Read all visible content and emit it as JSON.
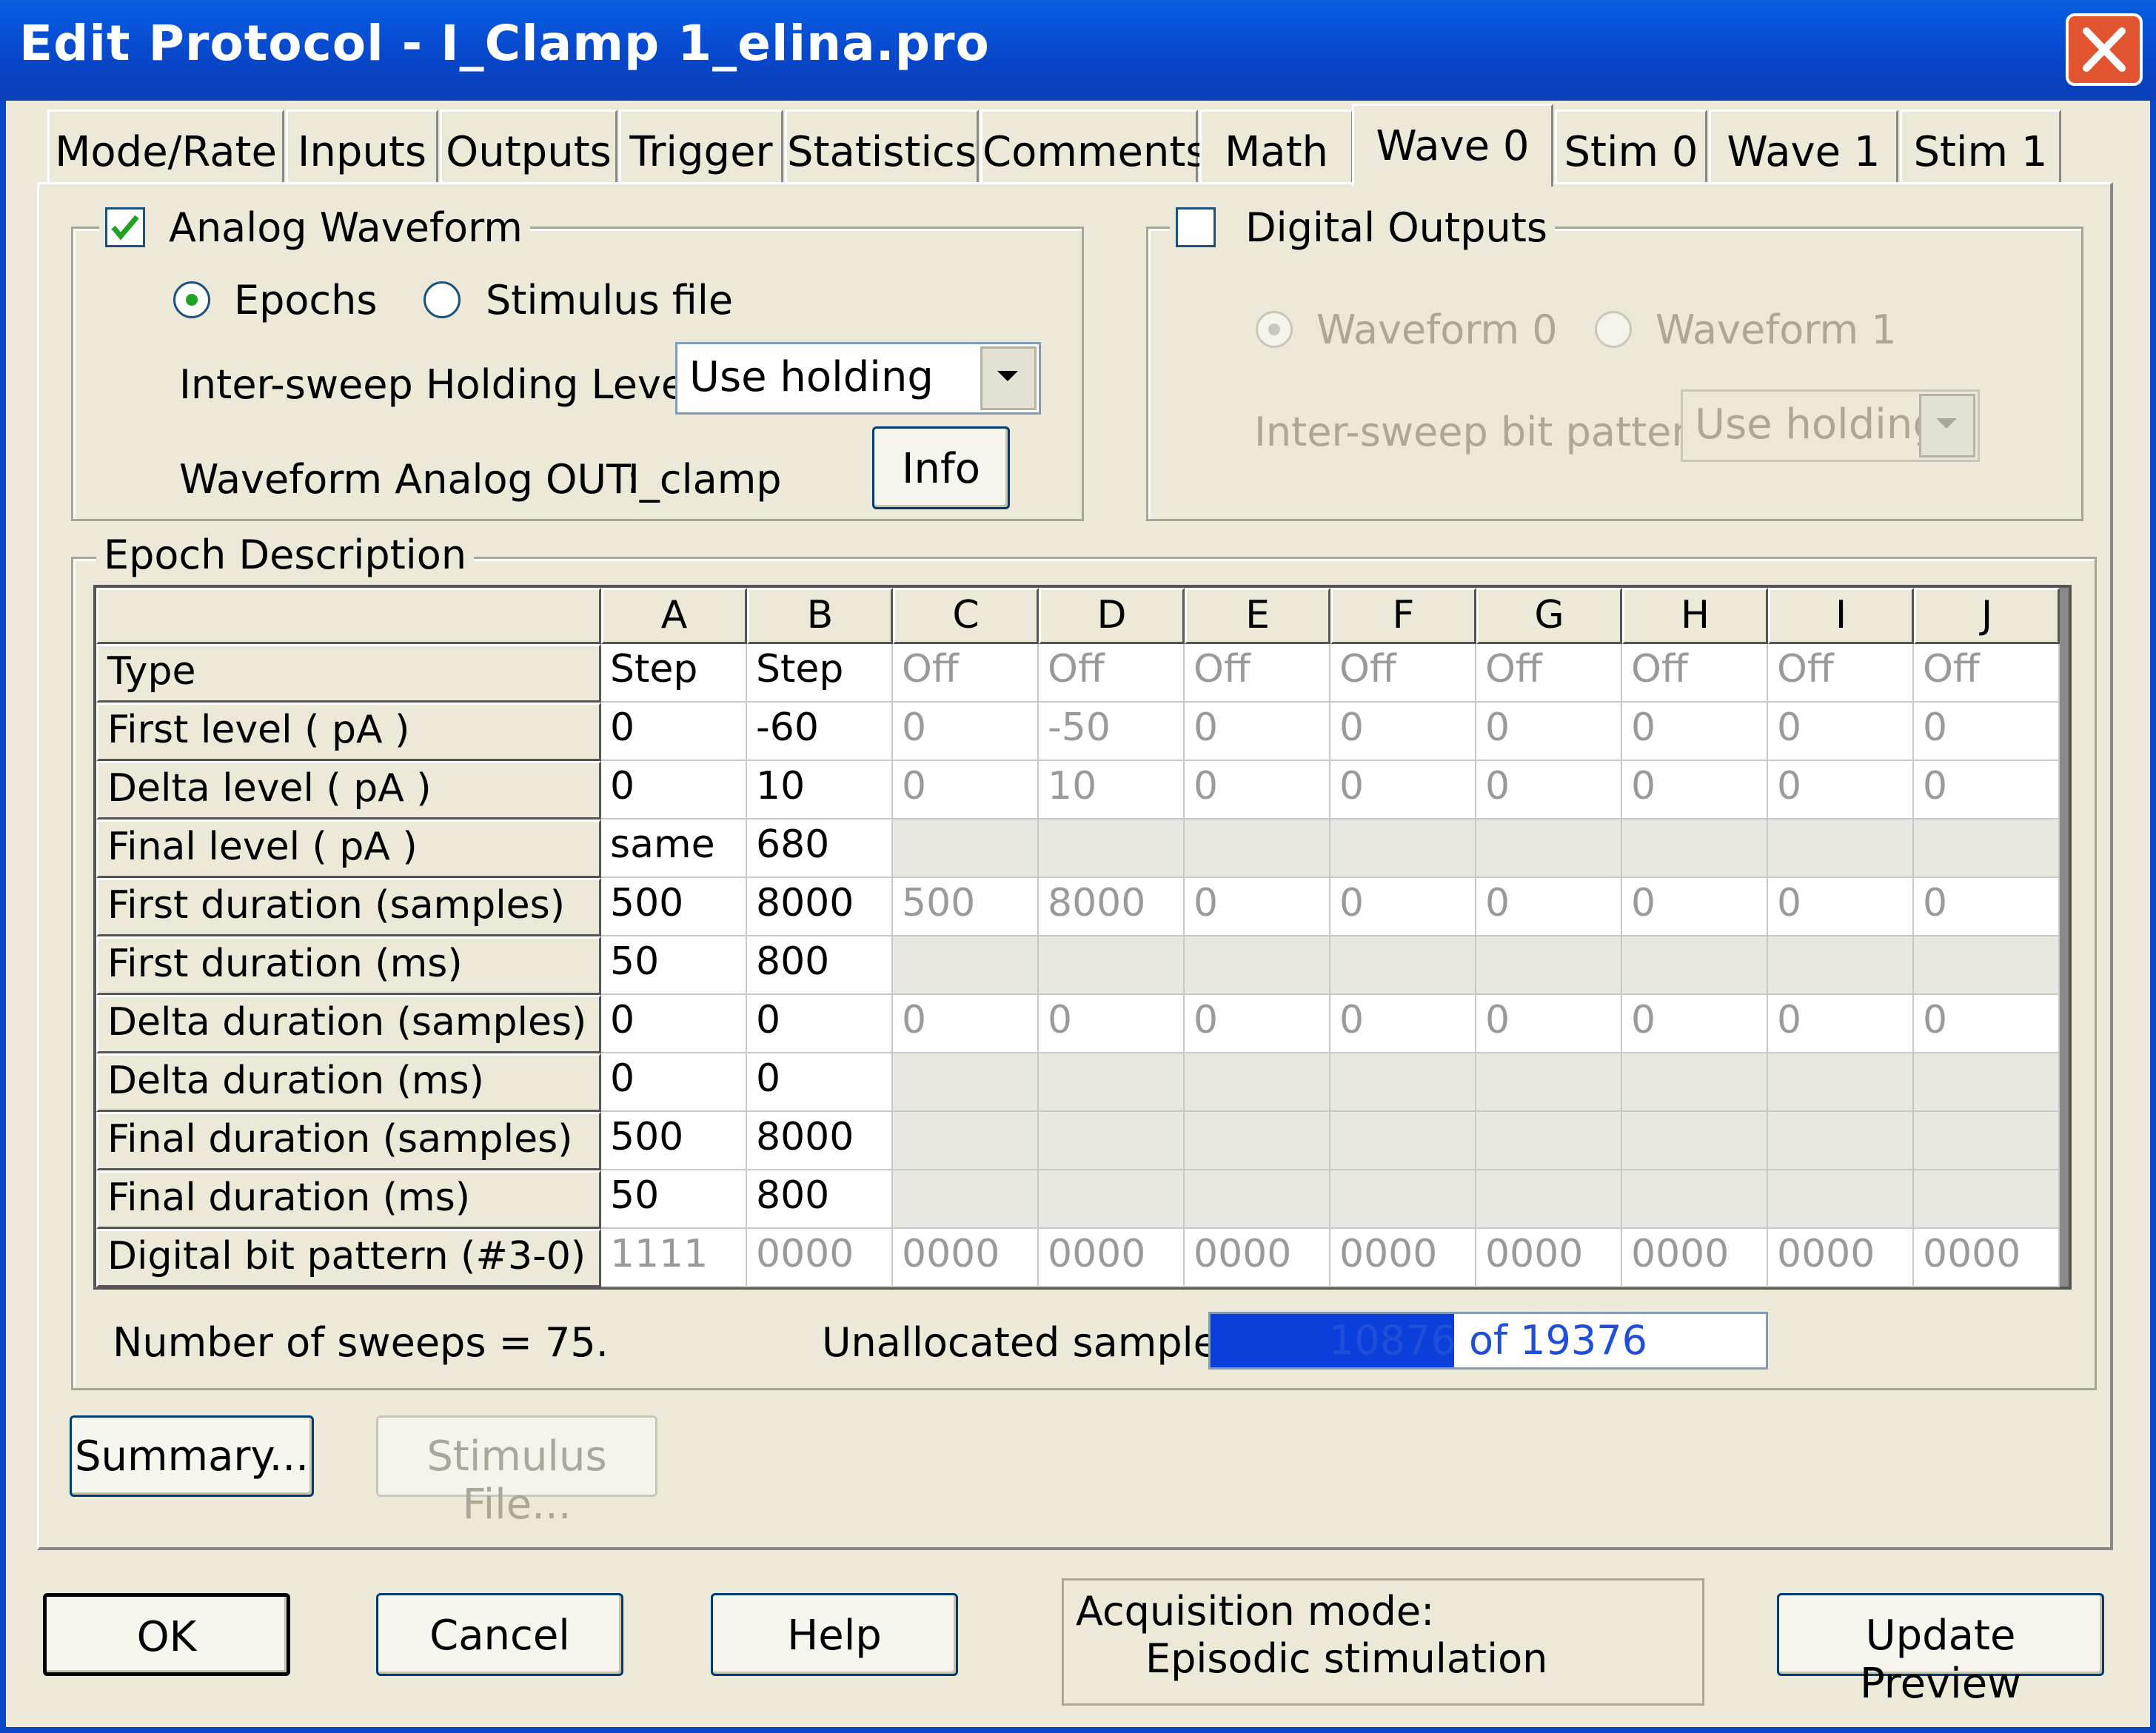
{
  "window": {
    "title": "Edit Protocol - I_Clamp 1_elina.pro"
  },
  "tabs": [
    {
      "label": "Mode/Rate"
    },
    {
      "label": "Inputs"
    },
    {
      "label": "Outputs"
    },
    {
      "label": "Trigger"
    },
    {
      "label": "Statistics"
    },
    {
      "label": "Comments"
    },
    {
      "label": "Math"
    },
    {
      "label": "Wave 0"
    },
    {
      "label": "Stim 0"
    },
    {
      "label": "Wave 1"
    },
    {
      "label": "Stim 1"
    }
  ],
  "active_tab": "Wave 0",
  "analog": {
    "label": "Analog Waveform",
    "checked": true,
    "epochs_label": "Epochs",
    "stimulus_file_label": "Stimulus file",
    "selected_source": "Epochs",
    "holding_label": "Inter-sweep Holding Level:",
    "holding_value": "Use holding",
    "out_label": "Waveform Analog OUT:",
    "out_value": "I_clamp",
    "info_button": "Info"
  },
  "digital": {
    "label": "Digital Outputs",
    "checked": false,
    "waveform0_label": "Waveform 0",
    "waveform1_label": "Waveform 1",
    "bit_pattern_label": "Inter-sweep bit pattern:",
    "bit_pattern_value": "Use holding"
  },
  "epoch": {
    "label": "Epoch Description",
    "columns": [
      "A",
      "B",
      "C",
      "D",
      "E",
      "F",
      "G",
      "H",
      "I",
      "J"
    ],
    "rows": [
      {
        "label": "Type",
        "cells": [
          "Step",
          "Step",
          "Off",
          "Off",
          "Off",
          "Off",
          "Off",
          "Off",
          "Off",
          "Off"
        ]
      },
      {
        "label": "First level ( pA )",
        "cells": [
          "0",
          "-60",
          "0",
          "-50",
          "0",
          "0",
          "0",
          "0",
          "0",
          "0"
        ]
      },
      {
        "label": "Delta level ( pA )",
        "cells": [
          "0",
          "10",
          "0",
          "10",
          "0",
          "0",
          "0",
          "0",
          "0",
          "0"
        ]
      },
      {
        "label": "Final level ( pA )",
        "cells": [
          "same",
          "680",
          "",
          "",
          "",
          "",
          "",
          "",
          "",
          ""
        ]
      },
      {
        "label": "First duration (samples)",
        "cells": [
          "500",
          "8000",
          "500",
          "8000",
          "0",
          "0",
          "0",
          "0",
          "0",
          "0"
        ]
      },
      {
        "label": "First duration (ms)",
        "cells": [
          "50",
          "800",
          "",
          "",
          "",
          "",
          "",
          "",
          "",
          ""
        ]
      },
      {
        "label": "Delta duration (samples)",
        "cells": [
          "0",
          "0",
          "0",
          "0",
          "0",
          "0",
          "0",
          "0",
          "0",
          "0"
        ]
      },
      {
        "label": "Delta duration (ms)",
        "cells": [
          "0",
          "0",
          "",
          "",
          "",
          "",
          "",
          "",
          "",
          ""
        ]
      },
      {
        "label": "Final duration (samples)",
        "cells": [
          "500",
          "8000",
          "",
          "",
          "",
          "",
          "",
          "",
          "",
          ""
        ]
      },
      {
        "label": "Final duration (ms)",
        "cells": [
          "50",
          "800",
          "",
          "",
          "",
          "",
          "",
          "",
          "",
          ""
        ]
      },
      {
        "label": "Digital bit pattern (#3-0)",
        "cells": [
          "1111",
          "0000",
          "0000",
          "0000",
          "0000",
          "0000",
          "0000",
          "0000",
          "0000",
          "0000"
        ]
      }
    ],
    "sweeps_text": "Number of sweeps = 75.",
    "unallocated_label": "Unallocated samples:",
    "unallocated_text": "10876 of 19376",
    "unallocated_used": 8500,
    "unallocated_total": 19376
  },
  "buttons": {
    "summary": "Summary...",
    "stimulus_file": "Stimulus File...",
    "ok": "OK",
    "cancel": "Cancel",
    "help": "Help",
    "update_preview": "Update Preview"
  },
  "acquisition": {
    "label": "Acquisition mode:",
    "value": "Episodic stimulation"
  },
  "colors": {
    "titlebar": "#0846c8",
    "face": "#ece9d8",
    "progress": "#0b3fdc"
  }
}
